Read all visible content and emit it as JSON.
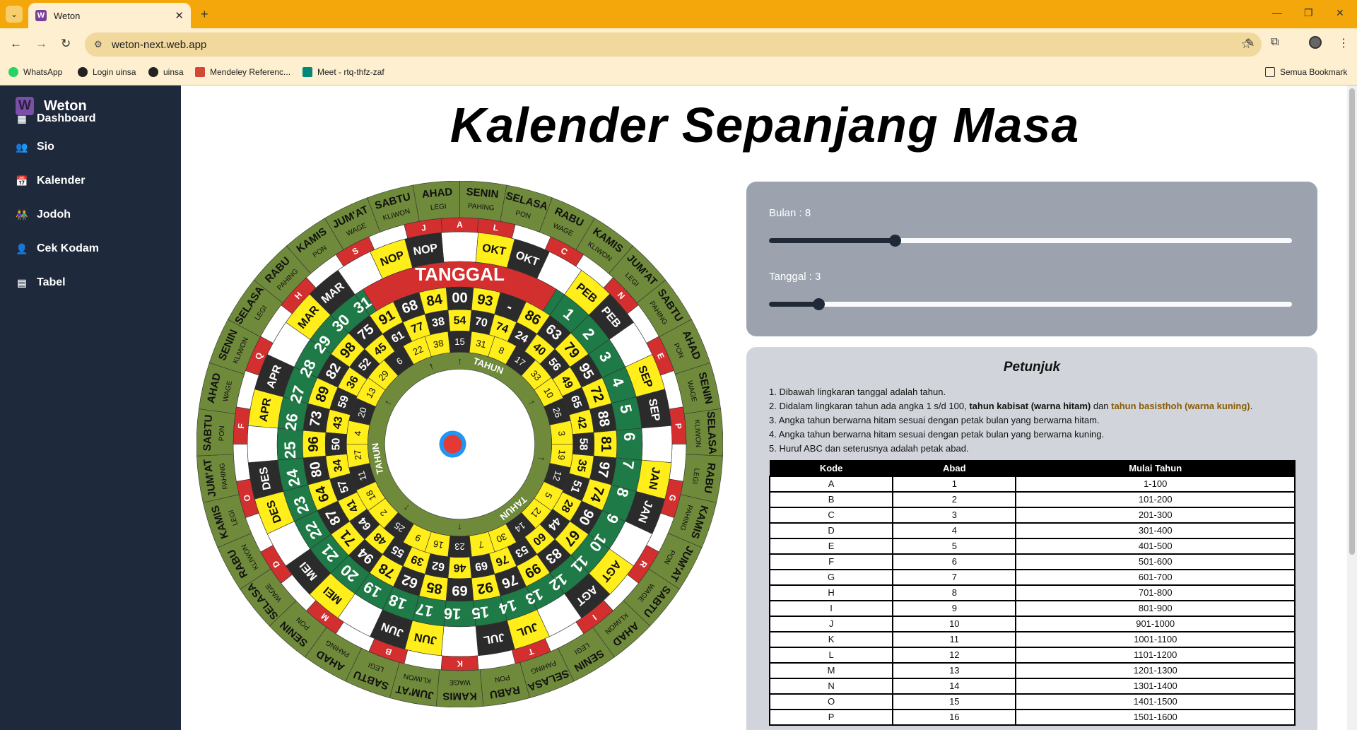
{
  "browser": {
    "tab_title": "Weton",
    "url": "weton-next.web.app",
    "bookmarks": [
      {
        "label": "WhatsApp",
        "icon": "whatsapp-icon",
        "color": "#25d366"
      },
      {
        "label": "Login uinsa",
        "icon": "globe-icon",
        "color": "#222"
      },
      {
        "label": "uinsa",
        "icon": "globe-icon",
        "color": "#222"
      },
      {
        "label": "Mendeley Referenc...",
        "icon": "mendeley-icon",
        "color": "#d14836"
      },
      {
        "label": "Meet - rtq-thfz-zaf",
        "icon": "meet-icon",
        "color": "#00897b"
      }
    ],
    "all_bookmarks": "Semua Bookmark"
  },
  "sidebar": {
    "brand": "Weton",
    "brand_logo": "W",
    "items": [
      {
        "label": "Dashboard",
        "icon": "dashboard-icon"
      },
      {
        "label": "Sio",
        "icon": "users-icon"
      },
      {
        "label": "Kalender",
        "icon": "calendar-icon"
      },
      {
        "label": "Jodoh",
        "icon": "couple-icon"
      },
      {
        "label": "Cek Kodam",
        "icon": "user-check-icon"
      },
      {
        "label": "Tabel",
        "icon": "table-icon"
      }
    ]
  },
  "page_title": "Kalender Sepanjang Masa",
  "controls": {
    "bulan_label": "Bulan : ",
    "bulan_value": "8",
    "bulan_fraction": 0.24,
    "tanggal_label": "Tanggal : ",
    "tanggal_value": "3",
    "tanggal_fraction": 0.095
  },
  "wheel": {
    "outer_days": [
      "SENIN",
      "SELASA",
      "RABU",
      "KAMIS",
      "JUM'AT",
      "SABTU",
      "AHAD",
      "SENIN",
      "SELASA",
      "RABU",
      "KAMIS",
      "JUM'AT",
      "SABTU",
      "AHAD",
      "SENIN",
      "SELASA",
      "RABU",
      "KAMIS",
      "JUM'AT",
      "SABTU",
      "AHAD",
      "SENIN",
      "SELASA",
      "RABU",
      "KAMIS",
      "JUM'AT",
      "SABTU",
      "AHAD",
      "SENIN",
      "SELASA",
      "RABU",
      "KAMIS",
      "JUM'AT",
      "SABTU",
      "AHAD"
    ],
    "pasaran": [
      "PAHING",
      "PON",
      "WAGE",
      "KLIWON",
      "LEGI"
    ],
    "abad_letters": [
      "A",
      "L",
      "",
      "C",
      "",
      "N",
      "",
      "E",
      "",
      "P",
      "",
      "G",
      "",
      "R",
      "",
      "I",
      "",
      "T",
      "",
      "K",
      "",
      "B",
      "",
      "M",
      "",
      "D",
      "",
      "O",
      "",
      "F",
      "",
      "Q",
      "",
      "H",
      "",
      "S",
      "",
      "J"
    ],
    "months_top": [
      "OKT",
      "PEB",
      "SEP",
      "JAN",
      "AGT",
      "JUL",
      "JUN",
      "MEI",
      "DES",
      "APR",
      "MAR",
      "NOP"
    ],
    "tanggal_label": "TANGGAL",
    "tahun_label": "TAHUN",
    "dates": [
      "1",
      "2",
      "3",
      "4",
      "5",
      "6",
      "7",
      "8",
      "9",
      "10",
      "11",
      "12",
      "13",
      "14",
      "15",
      "16",
      "17",
      "18",
      "19",
      "20",
      "21",
      "22",
      "23",
      "24",
      "25",
      "26",
      "27",
      "28",
      "29",
      "30",
      "31"
    ],
    "years_outer": [
      "00",
      "93",
      "-",
      "86",
      "63",
      "79",
      "95",
      "72",
      "88",
      "81",
      "97",
      "74",
      "90",
      "67",
      "83",
      "99",
      "76",
      "92",
      "69",
      "85",
      "62",
      "78",
      "94",
      "71",
      "87",
      "64",
      "80",
      "96",
      "73",
      "89",
      "82",
      "98",
      "75",
      "91",
      "68",
      "84"
    ],
    "years_mid": [
      "54",
      "70",
      "74",
      "24",
      "40",
      "56",
      "49",
      "65",
      "42",
      "58",
      "35",
      "51",
      "28",
      "44",
      "60",
      "53",
      "76",
      "69",
      "46",
      "62",
      "39",
      "55",
      "48",
      "64",
      "41",
      "57",
      "34",
      "50",
      "43",
      "59",
      "36",
      "52",
      "45",
      "61",
      "77",
      "38"
    ],
    "years_inner": [
      "15",
      "31",
      "8",
      "17",
      "33",
      "10",
      "26",
      "3",
      "19",
      "12",
      "5",
      "21",
      "14",
      "30",
      "7",
      "23",
      "16",
      "9",
      "25",
      "2",
      "18",
      "11",
      "27",
      "4",
      "20",
      "13",
      "29",
      "6",
      "22",
      "38"
    ],
    "colors": {
      "olive": "#6f8a3b",
      "green": "#1e7a46",
      "red": "#d32f2f",
      "yellow": "#ffee1a",
      "black": "#2b2b2b",
      "center_dot": "#e53935",
      "center_ring": "#2196f3"
    }
  },
  "petunjuk": {
    "title": "Petunjuk",
    "notes": [
      "1. Dibawah lingkaran tanggal adalah tahun.",
      "2. Didalam lingkaran tahun ada angka 1 s/d 100, ",
      "tahun kabisat (warna hitam)",
      " dan ",
      "tahun basisthoh (warna kuning)",
      ".",
      "3. Angka tahun berwarna hitam sesuai dengan petak bulan yang berwarna hitam.",
      "4. Angka tahun berwarna hitam sesuai dengan petak bulan yang berwarna kuning.",
      "5. Huruf ABC dan seterusnya adalah petak abad."
    ],
    "table": {
      "headers": [
        "Kode",
        "Abad",
        "Mulai Tahun"
      ],
      "rows": [
        [
          "A",
          "1",
          "1-100"
        ],
        [
          "B",
          "2",
          "101-200"
        ],
        [
          "C",
          "3",
          "201-300"
        ],
        [
          "D",
          "4",
          "301-400"
        ],
        [
          "E",
          "5",
          "401-500"
        ],
        [
          "F",
          "6",
          "501-600"
        ],
        [
          "G",
          "7",
          "601-700"
        ],
        [
          "H",
          "8",
          "701-800"
        ],
        [
          "I",
          "9",
          "801-900"
        ],
        [
          "J",
          "10",
          "901-1000"
        ],
        [
          "K",
          "11",
          "1001-1100"
        ],
        [
          "L",
          "12",
          "1101-1200"
        ],
        [
          "M",
          "13",
          "1201-1300"
        ],
        [
          "N",
          "14",
          "1301-1400"
        ],
        [
          "O",
          "15",
          "1401-1500"
        ],
        [
          "P",
          "16",
          "1501-1600"
        ]
      ]
    }
  }
}
